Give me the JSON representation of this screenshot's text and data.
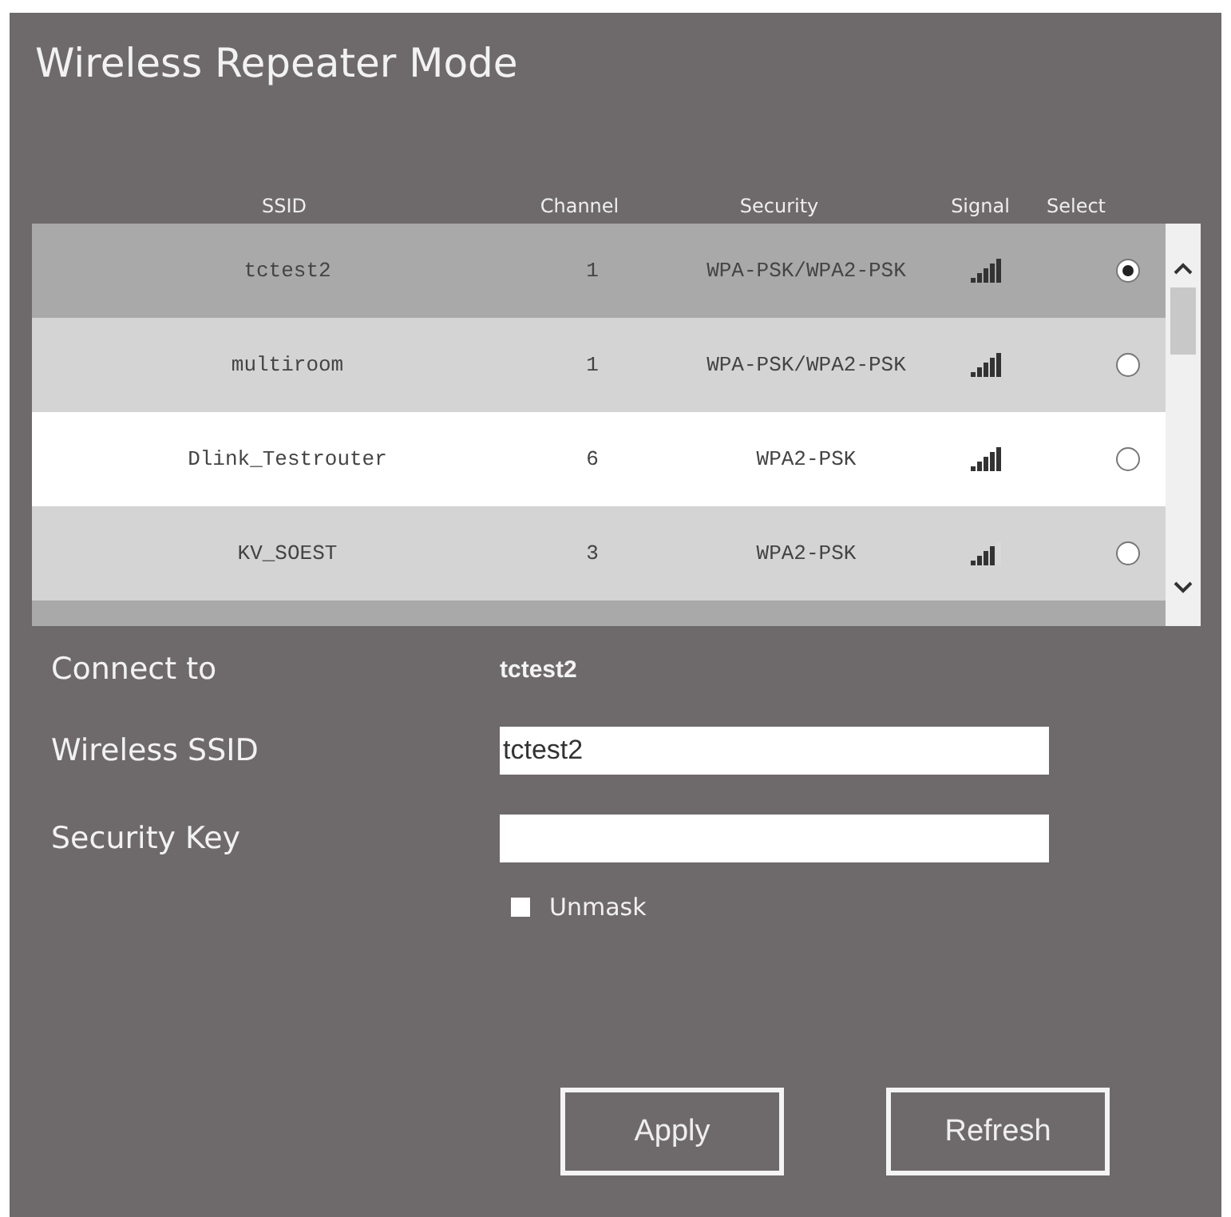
{
  "title": "Wireless Repeater Mode",
  "table": {
    "columns": [
      "SSID",
      "Channel",
      "Security",
      "Signal",
      "Select"
    ],
    "rows": [
      {
        "ssid": "tctest2",
        "channel": "1",
        "security": "WPA-PSK/WPA2-PSK",
        "weak_signal": false,
        "selected": true
      },
      {
        "ssid": "multiroom",
        "channel": "1",
        "security": "WPA-PSK/WPA2-PSK",
        "weak_signal": false,
        "selected": false
      },
      {
        "ssid": "Dlink_Testrouter",
        "channel": "6",
        "security": "WPA2-PSK",
        "weak_signal": false,
        "selected": false
      },
      {
        "ssid": "KV_SOEST",
        "channel": "3",
        "security": "WPA2-PSK",
        "weak_signal": true,
        "selected": false
      }
    ]
  },
  "form": {
    "connect_to": {
      "label": "Connect to",
      "value": "tctest2"
    },
    "wireless_ssid": {
      "label": "Wireless SSID",
      "value": "tctest2"
    },
    "security_key": {
      "label": "Security Key"
    },
    "unmask": {
      "label": "Unmask",
      "checked": false
    }
  },
  "buttons": [
    "Apply",
    "Refresh"
  ]
}
